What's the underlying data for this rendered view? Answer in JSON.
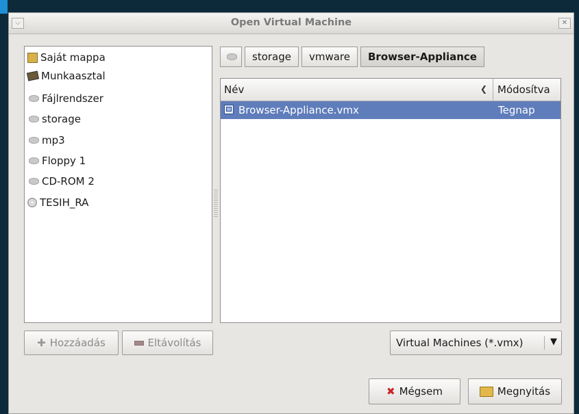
{
  "window": {
    "title": "Open Virtual Machine"
  },
  "places": [
    {
      "label": "Saját mappa",
      "icon": "home-folder-icon"
    },
    {
      "label": "Munkaasztal",
      "icon": "desktop-icon"
    },
    {
      "label": "Fájlrendszer",
      "icon": "drive-icon"
    },
    {
      "label": "storage",
      "icon": "drive-icon"
    },
    {
      "label": "mp3",
      "icon": "drive-icon"
    },
    {
      "label": "Floppy 1",
      "icon": "drive-icon"
    },
    {
      "label": "CD-ROM 2",
      "icon": "drive-icon"
    },
    {
      "label": "TESIH_RA",
      "icon": "cdrom-icon"
    }
  ],
  "pathbar": {
    "segments": [
      "storage",
      "vmware",
      "Browser-Appliance"
    ],
    "active": "Browser-Appliance"
  },
  "filelist": {
    "col_name": "Név",
    "col_modified": "Módosítva",
    "rows": [
      {
        "name": "Browser-Appliance.vmx",
        "modified": "Tegnap",
        "selected": true
      }
    ]
  },
  "buttons": {
    "add": "Hozzáadás",
    "remove": "Eltávolítás",
    "cancel": "Mégsem",
    "open": "Megnyitás"
  },
  "filter": {
    "selected": "Virtual Machines (*.vmx)"
  },
  "colors": {
    "selection": "#5f7dbb",
    "desktop_bg": "#0d2a3a"
  }
}
